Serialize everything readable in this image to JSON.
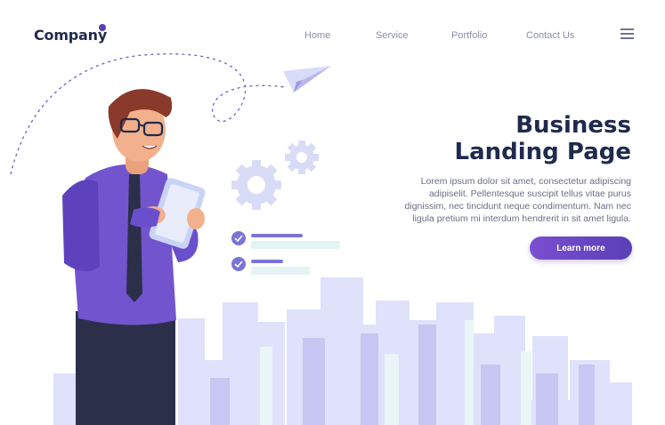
{
  "header": {
    "logo_text": "Company",
    "nav": [
      {
        "label": "Home"
      },
      {
        "label": "Service"
      },
      {
        "label": "Portfolio"
      },
      {
        "label": "Contact Us"
      }
    ],
    "menu_icon": "hamburger-menu-icon"
  },
  "hero": {
    "title_line1": "Business",
    "title_line2": "Landing Page",
    "body": "Lorem ipsum dolor sit amet, consectetur adipiscing adipiselit. Pellentesque suscipit tellus vitae purus dignissim, nec tincidunt neque condimentum. Nam nec ligula pretium mi interdum hendrerit in sit amet ligula.",
    "cta_label": "Learn more"
  },
  "colors": {
    "brand": "#5b3fb5",
    "heading": "#1f2a4d",
    "city": "#d9dcf7",
    "city_accent": "#b9b6ee"
  },
  "icons": [
    "paper-plane-icon",
    "gear-icon",
    "checkmark-icon"
  ]
}
